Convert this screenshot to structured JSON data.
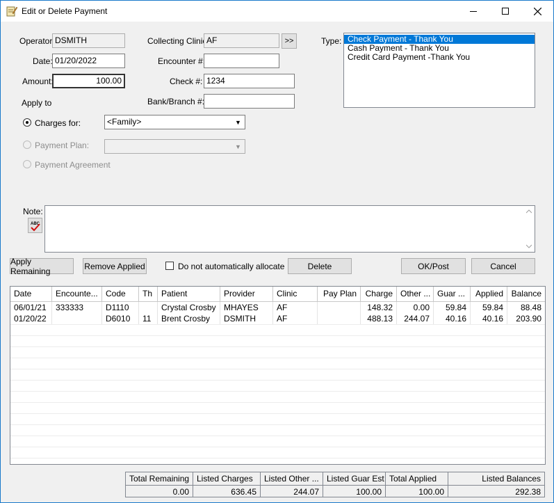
{
  "window": {
    "title": "Edit or Delete Payment"
  },
  "form": {
    "operator_label": "Operator:",
    "operator_value": "DSMITH",
    "date_label": "Date:",
    "date_value": "01/20/2022",
    "amount_label": "Amount:",
    "amount_value": "100.00",
    "apply_to_label": "Apply to",
    "collecting_clinic_label": "Collecting Clinic:",
    "collecting_clinic_value": "AF",
    "clinic_browse_label": ">>",
    "encounter_label": "Encounter #:",
    "encounter_value": "",
    "check_label": "Check #:",
    "check_value": "1234",
    "bank_label": "Bank/Branch #:",
    "bank_value": "",
    "type_label": "Type:",
    "note_label": "Note:",
    "note_value": ""
  },
  "type_options": [
    {
      "label": "Check Payment - Thank You",
      "selected": true
    },
    {
      "label": "Cash Payment - Thank You",
      "selected": false
    },
    {
      "label": "Credit Card Payment -Thank You",
      "selected": false
    }
  ],
  "apply": {
    "charges_for_label": "Charges for:",
    "charges_for_value": "<Family>",
    "payment_plan_label": "Payment Plan:",
    "payment_plan_value": "",
    "payment_agreement_label": "Payment Agreement"
  },
  "buttons": {
    "apply_remaining": "Apply Remaining",
    "remove_applied": "Remove Applied",
    "no_auto_allocate": "Do not automatically allocate",
    "delete": "Delete",
    "ok_post": "OK/Post",
    "cancel": "Cancel"
  },
  "grid": {
    "columns": [
      "Date",
      "Encounte...",
      "Code",
      "Th",
      "Patient",
      "Provider",
      "Clinic",
      "Pay Plan",
      "Charge",
      "Other ...",
      "Guar ...",
      "Applied",
      "Balance"
    ],
    "rows": [
      [
        "06/01/21",
        "333333",
        "D1110",
        "",
        "Crystal Crosby",
        "MHAYES",
        "AF",
        "",
        "148.32",
        "0.00",
        "59.84",
        "59.84",
        "88.48"
      ],
      [
        "01/20/22",
        "",
        "D6010",
        "11",
        "Brent Crosby",
        "DSMITH",
        "AF",
        "",
        "488.13",
        "244.07",
        "40.16",
        "40.16",
        "203.90"
      ]
    ]
  },
  "totals": {
    "headers": [
      "Total Remaining",
      "Listed Charges",
      "Listed Other ...",
      "Listed Guar Est",
      "Total Applied",
      "Listed Balances"
    ],
    "values": [
      "0.00",
      "636.45",
      "244.07",
      "100.00",
      "100.00",
      "292.38"
    ]
  },
  "colors": {
    "selection": "#0078d7",
    "window_border": "#1979ca"
  }
}
